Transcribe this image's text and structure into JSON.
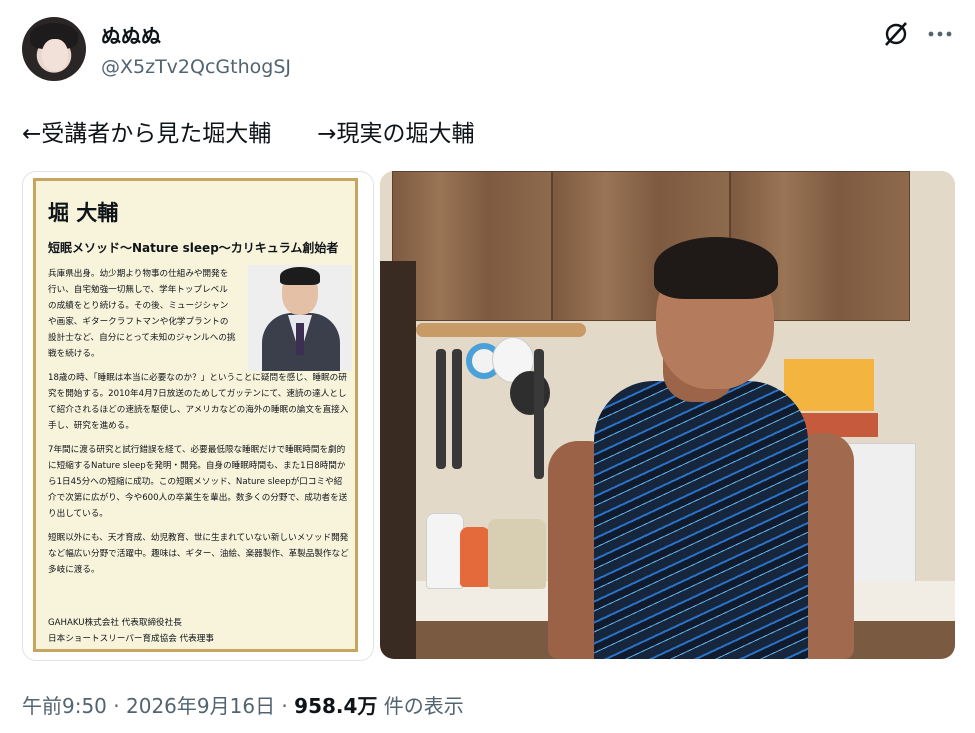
{
  "user": {
    "display_name": "ぬぬぬ",
    "handle": "@X5zTv2QcGthogSJ"
  },
  "icons": {
    "grok": "grok-icon",
    "more": "more-icon"
  },
  "tweet": {
    "text": "←受講者から見た堀大輔　　→現実の堀大輔"
  },
  "left_image": {
    "name": "堀 大輔",
    "title": "短眠メソッド〜Nature sleep〜カリキュラム創始者",
    "paragraphs": [
      "兵庫県出身。幼少期より物事の仕組みや開発を行い、自宅勉強一切無しで、学年トップレベルの成績をとり続ける。その後、ミュージシャンや画家、ギタークラフトマンや化学プラントの設計士など、自分にとって未知のジャンルへの挑戦を続ける。",
      "18歳の時、「睡眠は本当に必要なのか？」ということに疑問を感じ、睡眠の研究を開始する。2010年4月7日放送のためしてガッテンにて、速読の達人として紹介されるほどの速読を駆使し、アメリカなどの海外の睡眠の論文を直接入手し、研究を進める。",
      "7年間に渡る研究と試行錯誤を経て、必要最低限な睡眠だけで睡眠時間を劇的に短縮するNature sleepを発明・開発。自身の睡眠時間も、また1日8時間から1日45分への短縮に成功。この短眠メソッド、Nature sleepが口コミや紹介で次第に広がり、今や600人の卒業生を輩出。数多くの分野で、成功者を送り出している。",
      "短眠以外にも、天才育成、幼児教育、世に生まれていない新しいメソッド開発など幅広い分野で活躍中。趣味は、ギター、油絵、楽器製作、革製品製作など多岐に渡る。"
    ],
    "footer_line1": "GAHAKU株式会社 代表取締役社長",
    "footer_line2": "日本ショートスリーパー育成協会 代表理事"
  },
  "meta": {
    "time": "午前9:50",
    "sep1": " · ",
    "date": "2026年9月16日",
    "sep2": " · ",
    "views": "958.4万",
    "views_label": " 件の表示"
  }
}
